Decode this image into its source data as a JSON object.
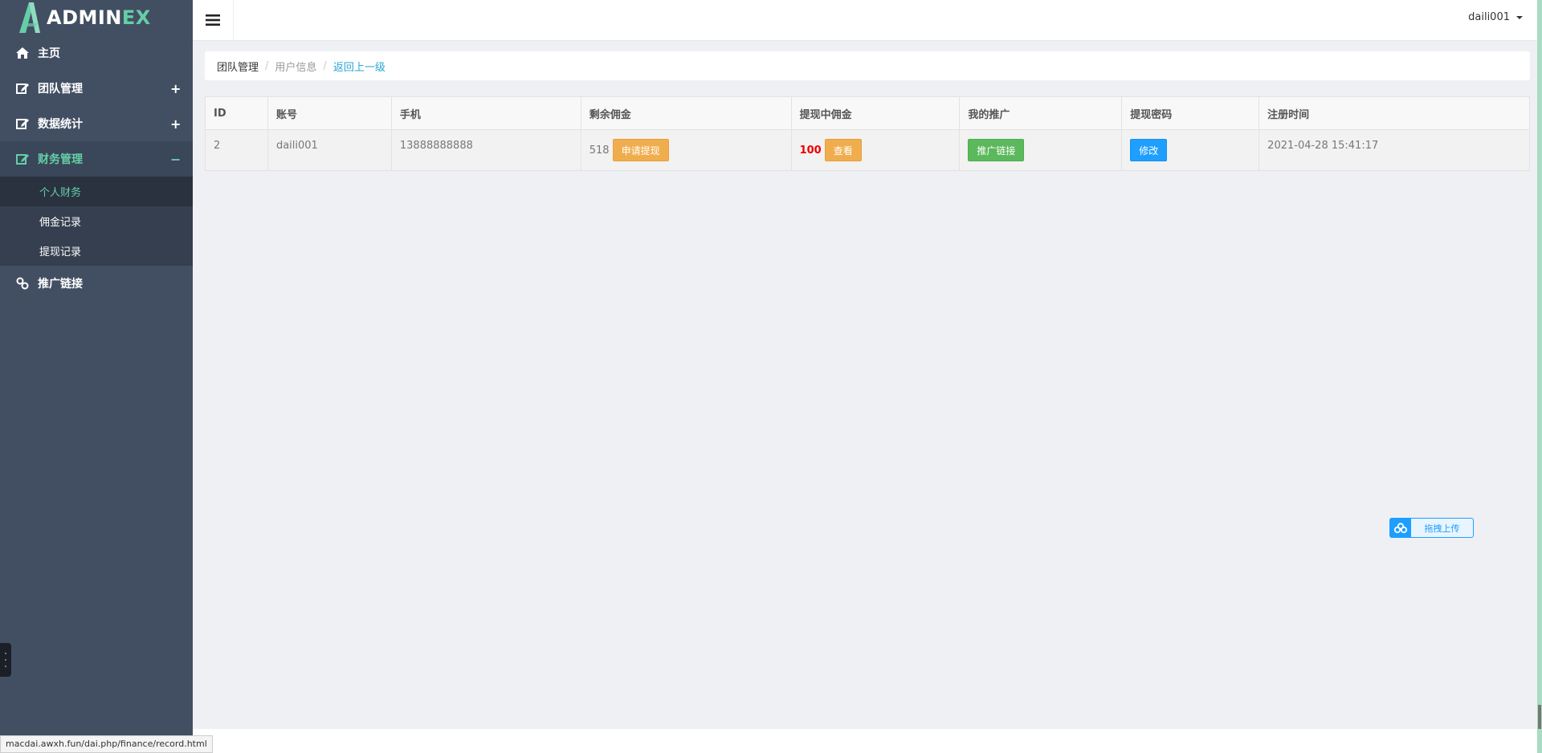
{
  "brand": {
    "prefix": "ADMIN",
    "suffix": "EX"
  },
  "sidebar": {
    "items": [
      {
        "label": "主页",
        "icon": "home-icon"
      },
      {
        "label": "团队管理",
        "icon": "edit-icon",
        "toggle": "+"
      },
      {
        "label": "数据统计",
        "icon": "edit-icon",
        "toggle": "+"
      },
      {
        "label": "财务管理",
        "icon": "edit-icon",
        "toggle": "−",
        "active": true,
        "children": [
          {
            "label": "个人财务",
            "current": true
          },
          {
            "label": "佣金记录"
          },
          {
            "label": "提现记录"
          }
        ]
      },
      {
        "label": "推广链接",
        "icon": "link-icon"
      }
    ]
  },
  "header": {
    "username": "daili001"
  },
  "breadcrumb": {
    "items": [
      "团队管理",
      "用户信息"
    ],
    "back": "返回上一级"
  },
  "table": {
    "columns": [
      "ID",
      "账号",
      "手机",
      "剩余佣金",
      "提现中佣金",
      "我的推广",
      "提现密码",
      "注册时间"
    ],
    "rows": [
      {
        "id": "2",
        "account": "daili001",
        "phone": "13888888888",
        "balance": "518",
        "balance_button": "申请提现",
        "pending": "100",
        "pending_button": "查看",
        "promo_button": "推广链接",
        "password_button": "修改",
        "registered": "2021-04-28 15:41:17"
      }
    ]
  },
  "upload": {
    "label": "拖拽上传"
  },
  "status_url": "macdai.awxh.fun/dai.php/finance/record.html",
  "colors": {
    "sidebar": "#424f63",
    "accent": "#65cea7",
    "orange": "#f0ad4e",
    "green": "#5cb85c",
    "blue": "#1e9fff"
  }
}
